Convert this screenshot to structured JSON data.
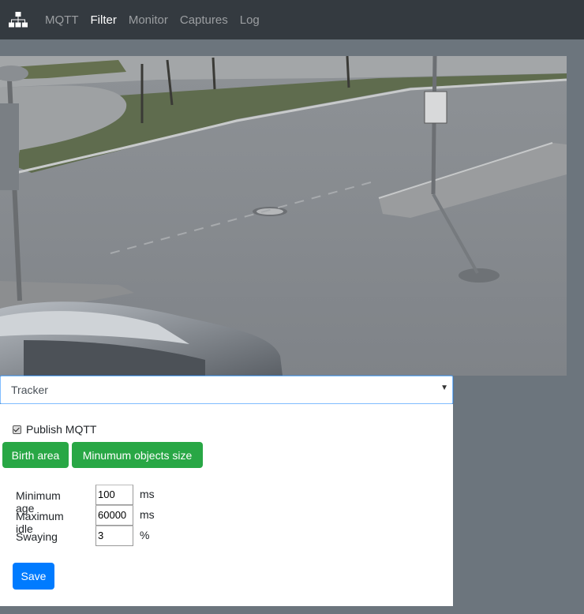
{
  "navbar": {
    "brand_icon": "sitemap-icon",
    "items": [
      {
        "label": "MQTT",
        "active": false
      },
      {
        "label": "Filter",
        "active": true
      },
      {
        "label": "Monitor",
        "active": false
      },
      {
        "label": "Captures",
        "active": false
      },
      {
        "label": "Log",
        "active": false
      }
    ]
  },
  "camera": {
    "description_icon": "camera-feed-image"
  },
  "tracker_select": {
    "selected": "Tracker",
    "caret_icon": "chevron-down-icon"
  },
  "panel": {
    "publish_mqtt": {
      "label": "Publish MQTT",
      "checked": true
    },
    "buttons": {
      "birth_area": "Birth area",
      "min_size": "Minumum objects size"
    },
    "fields": [
      {
        "label": "Minimum age",
        "value": "100",
        "unit": "ms"
      },
      {
        "label": "Maximum idle",
        "value": "60000",
        "unit": "ms"
      },
      {
        "label": "Swaying",
        "value": "3",
        "unit": "%"
      }
    ],
    "save_label": "Save"
  },
  "colors": {
    "navbar_bg": "#343a40",
    "page_bg": "#6c757d",
    "success": "#28a745",
    "primary": "#007bff"
  }
}
